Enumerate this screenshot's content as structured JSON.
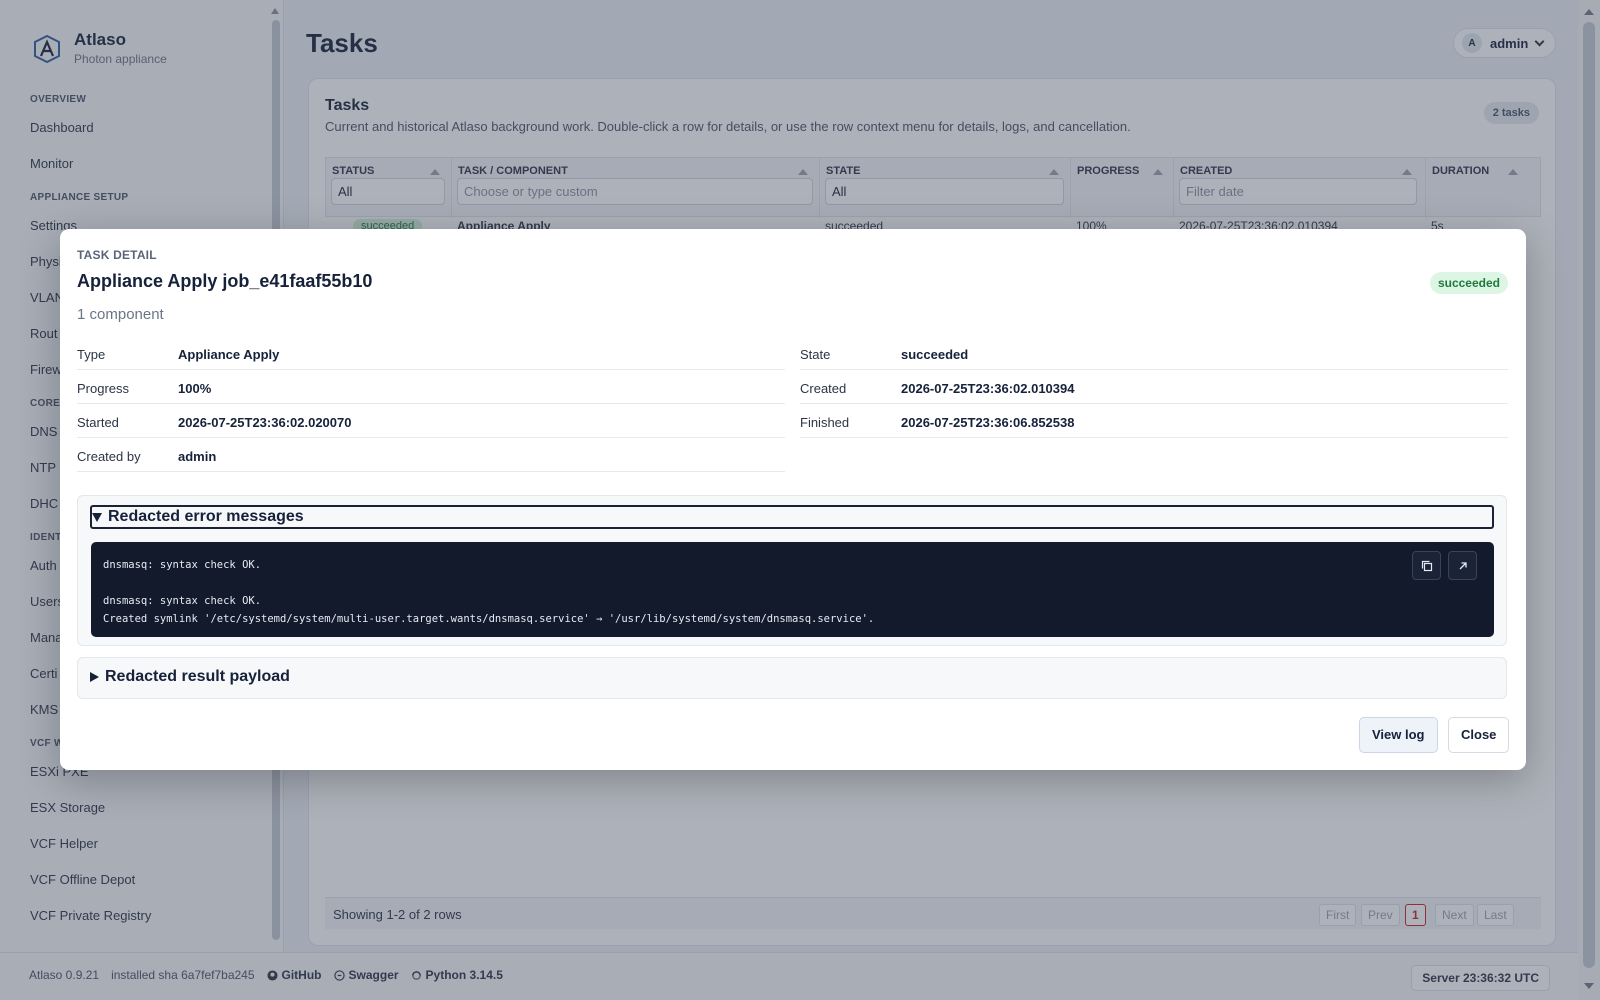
{
  "app": {
    "name": "Atlaso",
    "subtitle": "Photon appliance"
  },
  "nav": {
    "sections": [
      {
        "title": "OVERVIEW",
        "items": [
          "Dashboard",
          "Monitor"
        ]
      },
      {
        "title": "APPLIANCE SETUP",
        "items": [
          "Settings",
          "Physi",
          "VLAN",
          "Rout",
          "Firew"
        ]
      },
      {
        "title": "CORE",
        "items": [
          "DNS",
          "NTP",
          "DHC"
        ]
      },
      {
        "title": "IDENT",
        "items": [
          "Auth",
          "Users",
          "Mana",
          "Certi",
          "KMS"
        ]
      },
      {
        "title": "VCF W",
        "items": [
          "ESXi PXE",
          "ESX Storage",
          "VCF Helper",
          "VCF Offline Depot",
          "VCF Private Registry"
        ]
      }
    ]
  },
  "header": {
    "page_title": "Tasks",
    "user": {
      "initial": "A",
      "name": "admin"
    }
  },
  "card": {
    "title": "Tasks",
    "description": "Current and historical Atlaso background work. Double-click a row for details, or use the row context menu for details, logs, and cancellation.",
    "count": "2 tasks"
  },
  "table": {
    "columns": [
      {
        "label": "STATUS",
        "filter_value": "All",
        "filter_placeholder": ""
      },
      {
        "label": "TASK / COMPONENT",
        "filter_value": "",
        "filter_placeholder": "Choose or type custom"
      },
      {
        "label": "STATE",
        "filter_value": "All",
        "filter_placeholder": ""
      },
      {
        "label": "PROGRESS",
        "filter_value": "",
        "filter_placeholder": ""
      },
      {
        "label": "CREATED",
        "filter_value": "",
        "filter_placeholder": "Filter date"
      },
      {
        "label": "DURATION",
        "filter_value": "",
        "filter_placeholder": ""
      }
    ],
    "row": {
      "status": "succeeded",
      "task": "Appliance Apply",
      "state": "succeeded",
      "progress": "100%",
      "created": "2026-07-25T23:36:02.010394",
      "duration": "5s"
    },
    "pager": {
      "summary": "Showing 1-2 of 2 rows",
      "first": "First",
      "prev": "Prev",
      "current": "1",
      "next": "Next",
      "last": "Last"
    }
  },
  "modal": {
    "eyebrow": "TASK DETAIL",
    "title": "Appliance Apply job_e41faaf55b10",
    "subtitle": "1 component",
    "status": "succeeded",
    "fields_left": [
      {
        "label": "Type",
        "value": "Appliance Apply"
      },
      {
        "label": "Progress",
        "value": "100%"
      },
      {
        "label": "Started",
        "value": "2026-07-25T23:36:02.020070"
      },
      {
        "label": "Created by",
        "value": "admin"
      }
    ],
    "fields_right": [
      {
        "label": "State",
        "value": "succeeded"
      },
      {
        "label": "Created",
        "value": "2026-07-25T23:36:02.010394"
      },
      {
        "label": "Finished",
        "value": "2026-07-25T23:36:06.852538"
      }
    ],
    "errors_section": {
      "title": "Redacted error messages",
      "log": "dnsmasq: syntax check OK.\n\ndnsmasq: syntax check OK.\nCreated symlink '/etc/systemd/system/multi-user.target.wants/dnsmasq.service' → '/usr/lib/systemd/system/dnsmasq.service'."
    },
    "result_section": {
      "title": "Redacted result payload"
    },
    "buttons": {
      "view_log": "View log",
      "close": "Close"
    }
  },
  "footer": {
    "version": "Atlaso 0.9.21",
    "sha": "installed sha 6a7fef7ba245",
    "github": "GitHub",
    "swagger": "Swagger",
    "python": "Python 3.14.5",
    "server_time": "Server 23:36:32 UTC"
  },
  "colors": {
    "success_text": "#1f7a3c",
    "success_bg": "#ddf5e4",
    "code_bg": "#121a2b",
    "overlay": "rgba(60,70,88,0.42)"
  }
}
